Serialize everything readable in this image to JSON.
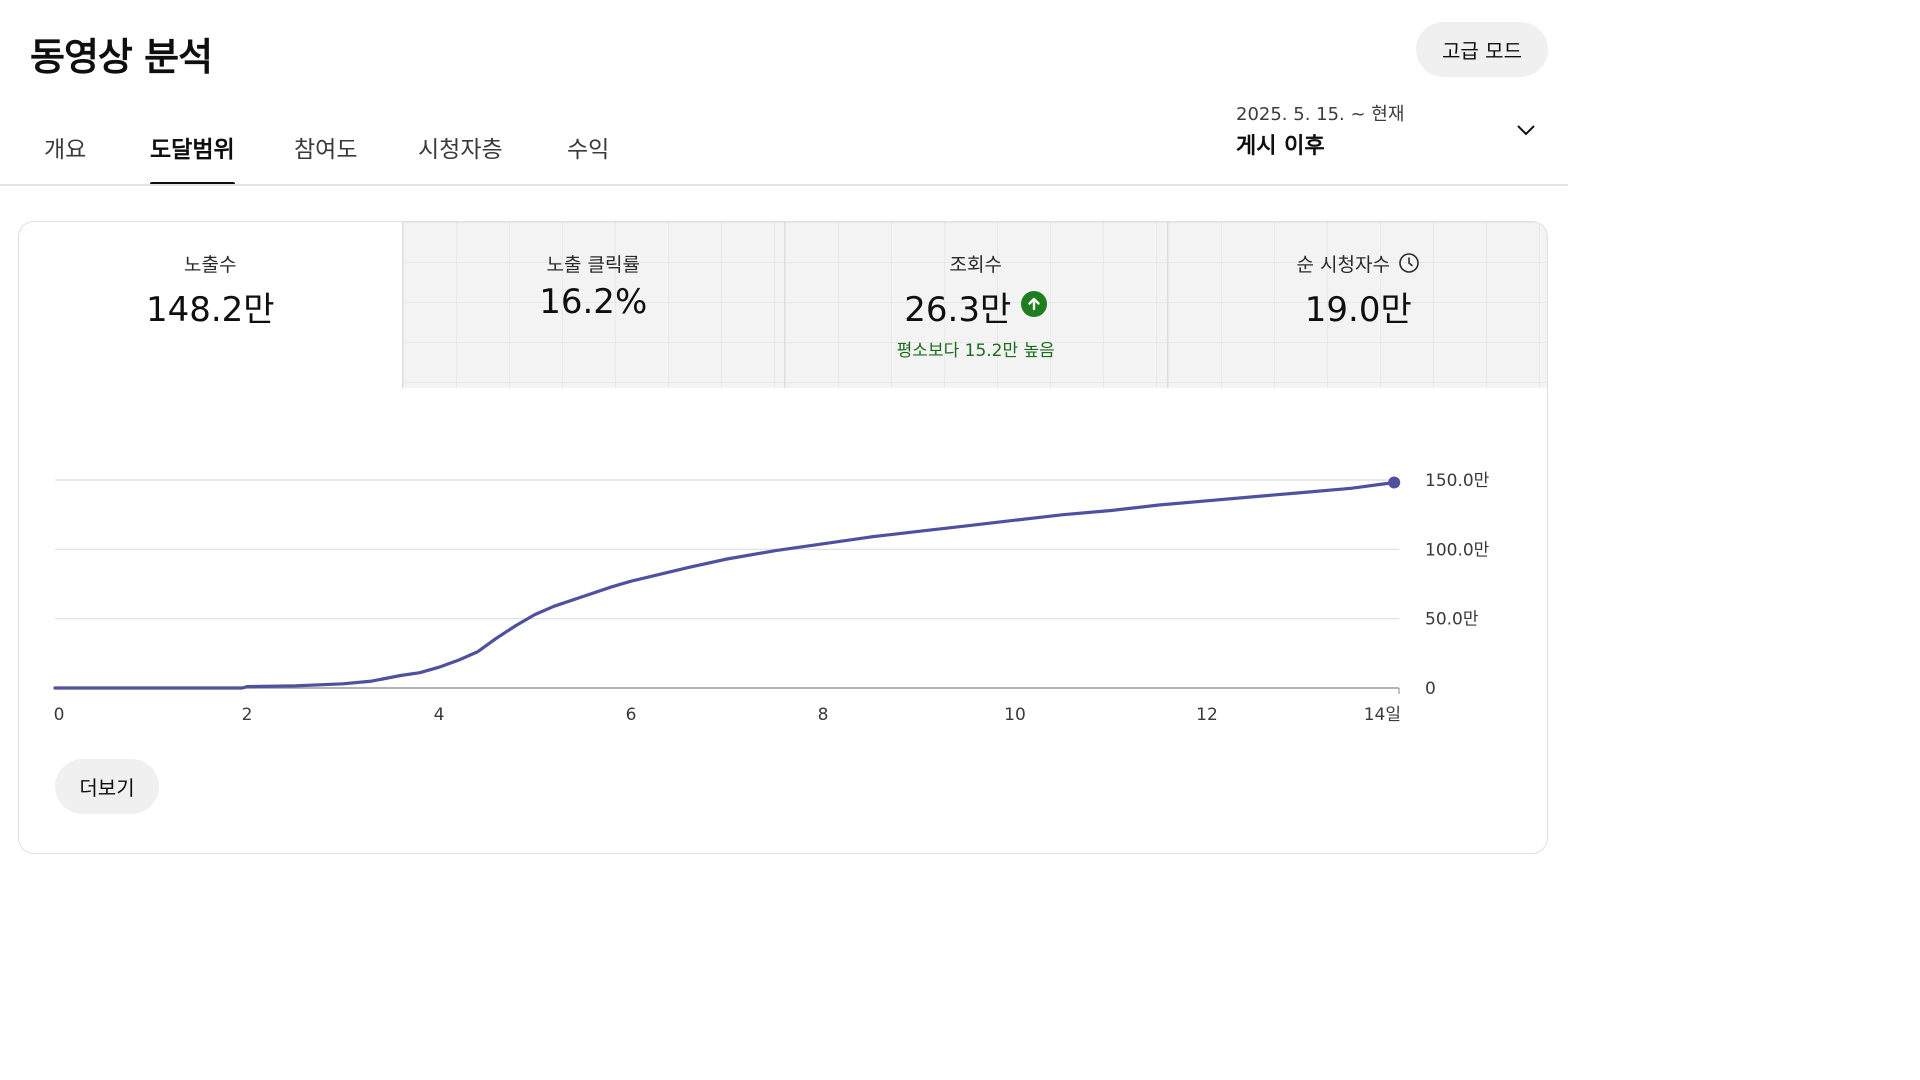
{
  "header": {
    "title": "동영상 분석",
    "advanced_mode": "고급 모드"
  },
  "tabs": [
    {
      "label": "개요",
      "active": false
    },
    {
      "label": "도달범위",
      "active": true
    },
    {
      "label": "참여도",
      "active": false
    },
    {
      "label": "시청자층",
      "active": false
    },
    {
      "label": "수익",
      "active": false
    }
  ],
  "date_range": {
    "period": "2025. 5. 15. ~ 현재",
    "label": "게시 이후",
    "icon": "chevron-down-icon"
  },
  "metrics": [
    {
      "label": "노출수",
      "value": "148.2만",
      "selected": true
    },
    {
      "label": "노출 클릭률",
      "value": "16.2%",
      "selected": false
    },
    {
      "label": "조회수",
      "value": "26.3만",
      "note": "평소보다 15.2만 높음",
      "icon": "arrow-up-circle-icon",
      "accent": "#1e7d1e",
      "selected": false
    },
    {
      "label": "순 시청자수",
      "value": "19.0만",
      "icon": "clock-icon",
      "selected": false
    }
  ],
  "more_button": "더보기",
  "chart_data": {
    "type": "line",
    "title": "",
    "xlabel": "",
    "ylabel": "",
    "x_ticks": [
      "0",
      "2",
      "4",
      "6",
      "8",
      "10",
      "12",
      "14일"
    ],
    "y_ticks": [
      "0",
      "50.0만",
      "100.0만",
      "150.0만"
    ],
    "xlim": [
      0,
      14
    ],
    "ylim": [
      0,
      150
    ],
    "y_unit": "만",
    "grid": true,
    "color": "#4f51a0",
    "series": [
      {
        "x": [
          0,
          0.5,
          1,
          1.5,
          1.95,
          2.0,
          2.5,
          3.0,
          3.3,
          3.6,
          3.8,
          4.0,
          4.2,
          4.4,
          4.6,
          4.8,
          5.0,
          5.2,
          5.5,
          5.8,
          6.0,
          6.3,
          6.6,
          7.0,
          7.5,
          8.0,
          8.5,
          9.0,
          9.5,
          10.0,
          10.5,
          11.0,
          11.5,
          12.0,
          12.5,
          13.0,
          13.5,
          13.95
        ],
        "values": [
          0,
          0,
          0,
          0,
          0,
          1,
          1.5,
          3,
          5,
          9,
          11,
          15,
          20,
          26,
          36,
          45,
          53,
          59,
          66,
          73,
          77,
          82,
          87,
          93,
          99,
          104,
          109,
          113,
          117,
          121,
          125,
          128,
          132,
          135,
          138,
          141,
          144,
          148.2
        ]
      }
    ]
  }
}
